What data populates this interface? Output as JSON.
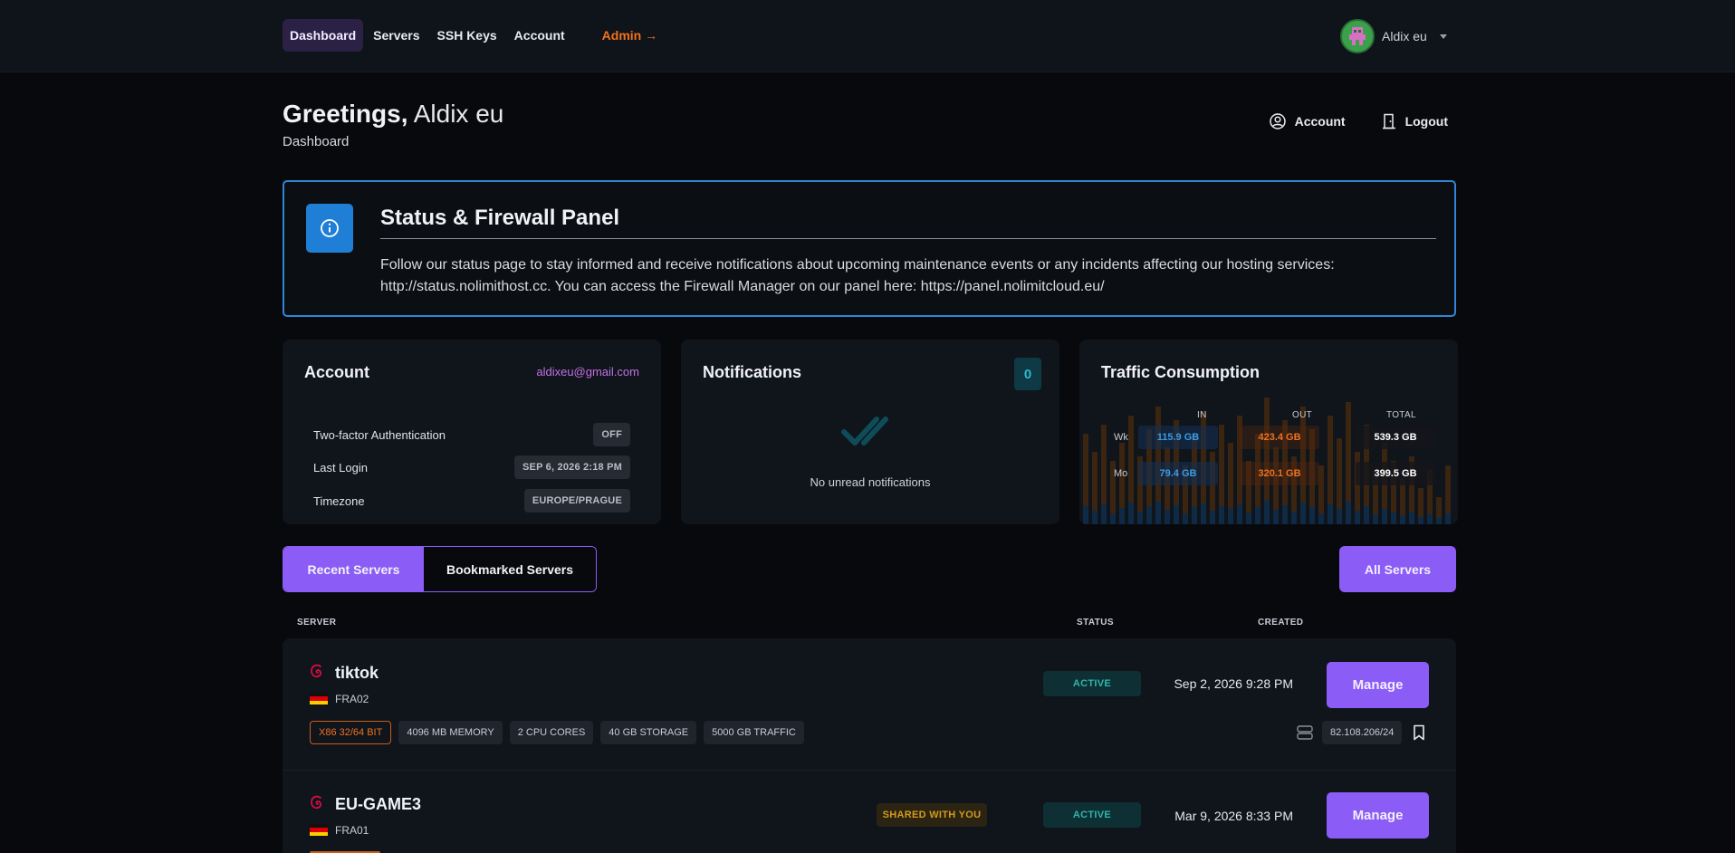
{
  "nav": {
    "links": [
      "Dashboard",
      "Servers",
      "SSH Keys",
      "Account"
    ],
    "admin_label": "Admin →",
    "user_name": "Aldix eu"
  },
  "header": {
    "greeting_bold": "Greetings,",
    "greeting_name": "Aldix eu",
    "subtitle": "Dashboard",
    "account_label": "Account",
    "logout_label": "Logout"
  },
  "alert": {
    "title": "Status & Firewall Panel",
    "body": "Follow our status page to stay informed and receive notifications about upcoming maintenance events or any incidents affecting our hosting services: http://status.nolimithost.cc. You can access the Firewall Manager on our panel here: https://panel.nolimitcloud.eu/"
  },
  "account_card": {
    "title": "Account",
    "email": "aldixeu@gmail.com",
    "rows": [
      {
        "label": "Two-factor Authentication",
        "value": "OFF"
      },
      {
        "label": "Last Login",
        "value": "SEP 6, 2026 2:18 PM"
      },
      {
        "label": "Timezone",
        "value": "EUROPE/PRAGUE"
      }
    ]
  },
  "notifications_card": {
    "title": "Notifications",
    "count": "0",
    "empty_text": "No unread notifications"
  },
  "traffic_card": {
    "title": "Traffic Consumption",
    "headers": [
      "IN",
      "OUT",
      "TOTAL"
    ],
    "rows": [
      {
        "label": "Wk",
        "in": "115.9 GB",
        "out": "423.4 GB",
        "total": "539.3 GB"
      },
      {
        "label": "Mo",
        "in": "79.4 GB",
        "out": "320.1 GB",
        "total": "399.5 GB"
      }
    ]
  },
  "tabs": {
    "recent": "Recent Servers",
    "bookmarked": "Bookmarked Servers",
    "all_servers": "All Servers"
  },
  "table_headers": {
    "server": "SERVER",
    "status": "STATUS",
    "created": "CREATED"
  },
  "servers": [
    {
      "name": "tiktok",
      "location": "FRA02",
      "specs": [
        "X86 32/64 BIT",
        "4096 MB MEMORY",
        "2 CPU CORES",
        "40 GB STORAGE",
        "5000 GB TRAFFIC"
      ],
      "status": "ACTIVE",
      "created": "Sep 2, 2026 9:28 PM",
      "ip": "82.108.206/24",
      "manage_label": "Manage"
    },
    {
      "name": "EU-GAME3",
      "location": "FRA01",
      "shared": "SHARED WITH YOU",
      "status": "ACTIVE",
      "created": "Mar 9, 2026 8:33 PM",
      "manage_label": "Manage"
    }
  ],
  "colors": {
    "accent": "#8b5cf6",
    "info": "#1f7fd6",
    "orange": "#f0731e",
    "status_active": "#2fb6aa"
  }
}
